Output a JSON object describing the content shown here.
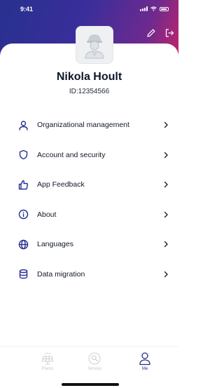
{
  "status_bar": {
    "time": "9:41"
  },
  "profile": {
    "name": "Nikola Hoult",
    "id": "ID:12354566"
  },
  "menu": [
    {
      "label": "Organizational management",
      "icon": "person-icon"
    },
    {
      "label": "Account and security",
      "icon": "shield-icon"
    },
    {
      "label": "App Feedback",
      "icon": "thumbs-up-icon"
    },
    {
      "label": "About",
      "icon": "info-icon"
    },
    {
      "label": "Languages",
      "icon": "globe-icon"
    },
    {
      "label": "Data migration",
      "icon": "database-icon"
    }
  ],
  "tabs": [
    {
      "label": "Plants",
      "icon": "solar-panel-icon",
      "active": false
    },
    {
      "label": "Service",
      "icon": "wrench-icon",
      "active": false
    },
    {
      "label": "Me",
      "icon": "person-icon",
      "active": true
    }
  ],
  "colors": {
    "accent": "#27308f",
    "gradient_end": "#c0246a",
    "inactive_tab": "#c5c9d0"
  }
}
